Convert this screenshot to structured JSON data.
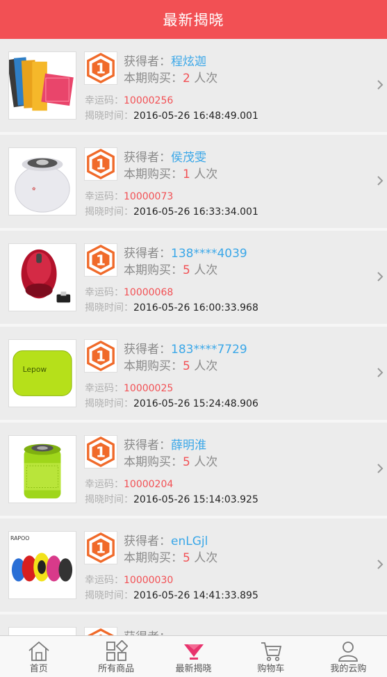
{
  "header": {
    "title": "最新揭晓"
  },
  "labels": {
    "winner": "获得者：",
    "purchase": "本期购买：",
    "times_unit": " 人次",
    "lucky": "幸运码：",
    "reveal_time": "揭晓时间："
  },
  "badge_number": "1",
  "items": [
    {
      "product_icon": "notebooks-icon",
      "winner": "程炫迦",
      "count": "2",
      "code": "10000256",
      "time": "2016-05-26 16:48:49.001"
    },
    {
      "product_icon": "speaker-white-icon",
      "winner": "侯茂雯",
      "count": "1",
      "code": "10000073",
      "time": "2016-05-26 16:33:34.001"
    },
    {
      "product_icon": "mouse-red-icon",
      "winner": "138****4039",
      "count": "5",
      "code": "10000068",
      "time": "2016-05-26 16:00:33.968"
    },
    {
      "product_icon": "power-bank-icon",
      "product_text": "Lepow",
      "winner": "183****7729",
      "count": "5",
      "code": "10000025",
      "time": "2016-05-26 15:24:48.906"
    },
    {
      "product_icon": "speaker-green-icon",
      "winner": "薛明淮",
      "count": "5",
      "code": "10000204",
      "time": "2016-05-26 15:14:03.925"
    },
    {
      "product_icon": "mice-group-icon",
      "product_text": "RAPOO",
      "winner": "enLGjl",
      "count": "5",
      "code": "10000030",
      "time": "2016-05-26 14:41:33.895"
    },
    {
      "product_icon": "partial-item-icon",
      "winner": "",
      "count": "",
      "code": "",
      "time": ""
    }
  ],
  "tabbar": {
    "tabs": [
      {
        "label": "首页",
        "icon": "home-icon"
      },
      {
        "label": "所有商品",
        "icon": "grid-icon"
      },
      {
        "label": "最新揭晓",
        "icon": "diamond-icon",
        "active": true
      },
      {
        "label": "购物车",
        "icon": "cart-icon"
      },
      {
        "label": "我的云购",
        "icon": "user-icon"
      }
    ]
  },
  "colors": {
    "brand": "#f25054",
    "name": "#3aa7e8",
    "badge": "#f06a2a",
    "active_tab": "#e8336d"
  }
}
